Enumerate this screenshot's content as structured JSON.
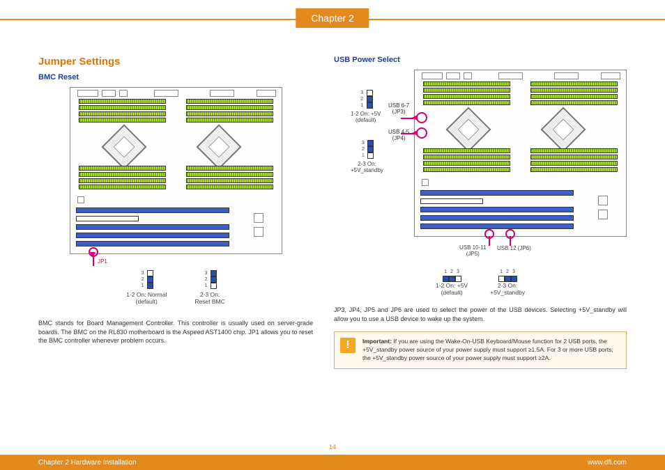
{
  "chapter": {
    "tab": "Chapter 2"
  },
  "left": {
    "h1": "Jumper Settings",
    "h2": "BMC Reset",
    "jp1_label": "JP1",
    "legend1": {
      "nums": [
        "3",
        "2",
        "1"
      ],
      "caption1": "1-2 On: Normal",
      "caption2": "(default)"
    },
    "legend2": {
      "nums": [
        "3",
        "2",
        "1"
      ],
      "caption1": "2-3 On:",
      "caption2": "Reset BMC"
    },
    "body": "BMC stands for Board Management Controller. This controller is usually used on server-grade boards. The BMC on the RL830 motherboard is the Aspeed AST1400 chip. JP1 allows you to reset the BMC controller whenever problem occurs."
  },
  "right": {
    "h2": "USB Power Select",
    "top_v1": {
      "nums": [
        "3",
        "2",
        "1"
      ],
      "cap1": "1-2 On: +5V",
      "cap2": "(default)"
    },
    "top_v2": {
      "nums": [
        "3",
        "2",
        "1"
      ],
      "cap1": "2-3 On:",
      "cap2": "+5V_standby"
    },
    "lbl_usb67": "USB 6-7\n(JP3)",
    "lbl_usb45": "USB 4-5\n(JP4)",
    "bot_lbl1": "USB 10-11\n(JP5)",
    "bot_lbl2": "USB 12 (JP6)",
    "h_legend1": {
      "nums": [
        "1",
        "2",
        "3"
      ],
      "cap1": "1-2 On: +5V",
      "cap2": "(default)"
    },
    "h_legend2": {
      "nums": [
        "1",
        "2",
        "3"
      ],
      "cap1": "2-3 On:",
      "cap2": "+5V_standby"
    },
    "body": "JP3, JP4, JP5 and JP6 are used to select the power of the USB devices. Selecting +5V_standby will allow you to use a USB device to wake up the system.",
    "important_title": "Important:",
    "important_body": "If you are using the Wake-On-USB Keyboard/Mouse function for 2 USB ports, the +5V_standby power source of your power supply must support ≥1.5A. For 3 or more USB ports, the +5V_standby power source of your power supply must support ≥2A."
  },
  "footer": {
    "left": "Chapter 2 Hardware Installation",
    "right": "www.dfi.com",
    "page": "14"
  }
}
